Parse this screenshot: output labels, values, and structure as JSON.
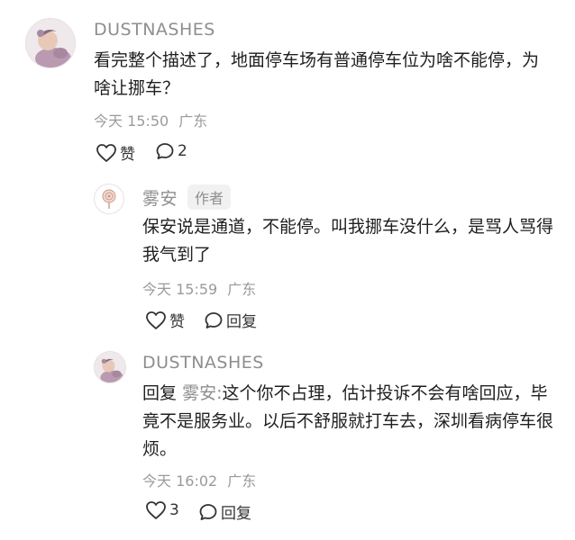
{
  "comments": [
    {
      "username": "DUSTNASHES",
      "text": "看完整个描述了，地面停车场有普通停车位为啥不能停，为啥让挪车？",
      "time": "今天 15:50",
      "location": "广东",
      "like_label": "赞",
      "reply_count": "2"
    },
    {
      "username": "雾安",
      "badge": "作者",
      "text": "保安说是通道，不能停。叫我挪车没什么，是骂人骂得我气到了",
      "time": "今天 15:59",
      "location": "广东",
      "like_label": "赞",
      "reply_label": "回复"
    },
    {
      "username": "DUSTNASHES",
      "reply_prefix": "回复",
      "mention": "雾安:",
      "text": "这个你不占理，估计投诉不会有啥回应，毕竟不是服务业。以后不舒服就打车去，深圳看病停车很烦。",
      "time": "今天 16:02",
      "location": "广东",
      "like_count": "3",
      "reply_label": "回复"
    }
  ],
  "icons": {
    "like": "heart-outline-icon",
    "comment": "speech-bubble-icon"
  },
  "colors": {
    "secondary_text": "#8e8e8e",
    "primary_text": "#1f1f1f",
    "badge_bg": "#f1f1f1"
  }
}
